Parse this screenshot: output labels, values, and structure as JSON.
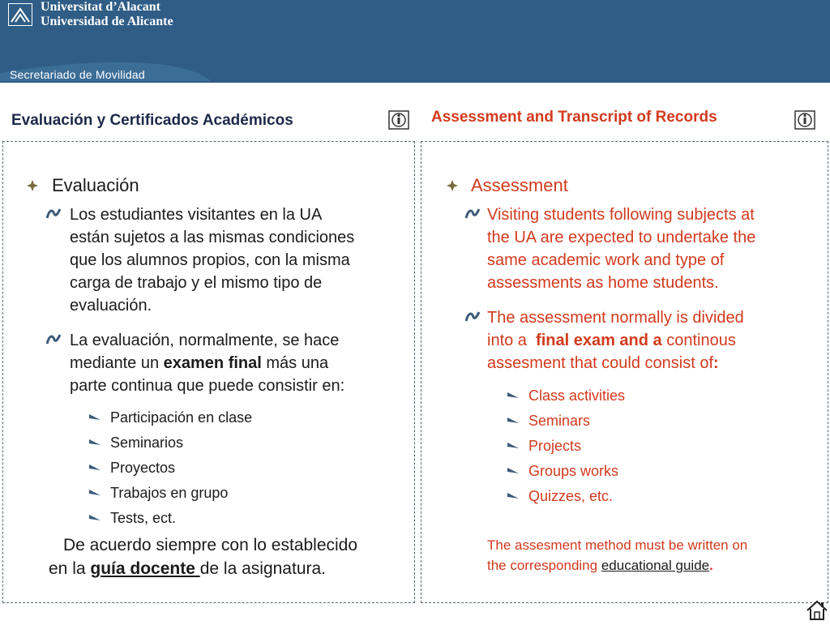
{
  "header": {
    "university_ca": "Universitat d’Alacant",
    "university_es": "Universidad de Alicante",
    "department": "Secretariado de Movilidad"
  },
  "left": {
    "title": "Evaluación y Certificados Académicos",
    "heading": "Evaluación",
    "para1": [
      "Los estudiantes visitantes en la UA",
      "están sujetos a las mismas condiciones",
      "que los alumnos propios, con la misma",
      "carga de trabajo y el mismo tipo de",
      "evaluación."
    ],
    "para2": {
      "line1": "La evaluación, normalmente, se hace",
      "line2_pre": "mediante un ",
      "line2_bold": "examen final",
      "line2_post": " más una",
      "line3": "parte continua que puede consistir en:"
    },
    "items": [
      "Participación en clase",
      "Seminarios",
      "Proyectos",
      "Trabajos en grupo",
      "Tests, ect."
    ],
    "closing": {
      "line1": "De acuerdo siempre con lo establecido",
      "line2_pre": "en la ",
      "line2_link": "guía docente ",
      "line2_post": "de la asignatura."
    }
  },
  "right": {
    "title": "Assessment and Transcript of Records",
    "heading": "Assessment",
    "para1": [
      "Visiting students following subjects at",
      "the UA are expected to undertake the",
      "same academic work and type of",
      "assessments as home students."
    ],
    "para2": {
      "line1": "The assessment normally is divided",
      "line2_pre": "into a  ",
      "line2_bold": "final exam and a",
      "line2_post": " continous",
      "line3_pre": "assesment that could consist of",
      "line3_bold": ":"
    },
    "items": [
      "Class activities",
      "Seminars",
      "Projects",
      "Groups works",
      "Quizzes, etc."
    ],
    "note": {
      "line1": "The assesment method must be written on",
      "line2_pre": "the corresponding ",
      "line2_link": "educational guide",
      "line2_post": "."
    }
  },
  "colors": {
    "header_bg": "#2f5d86",
    "english_text": "#d23a1e",
    "spanish_text": "#1b1b1b"
  },
  "icons": [
    "info-icon",
    "home-icon",
    "university-logo-icon"
  ]
}
